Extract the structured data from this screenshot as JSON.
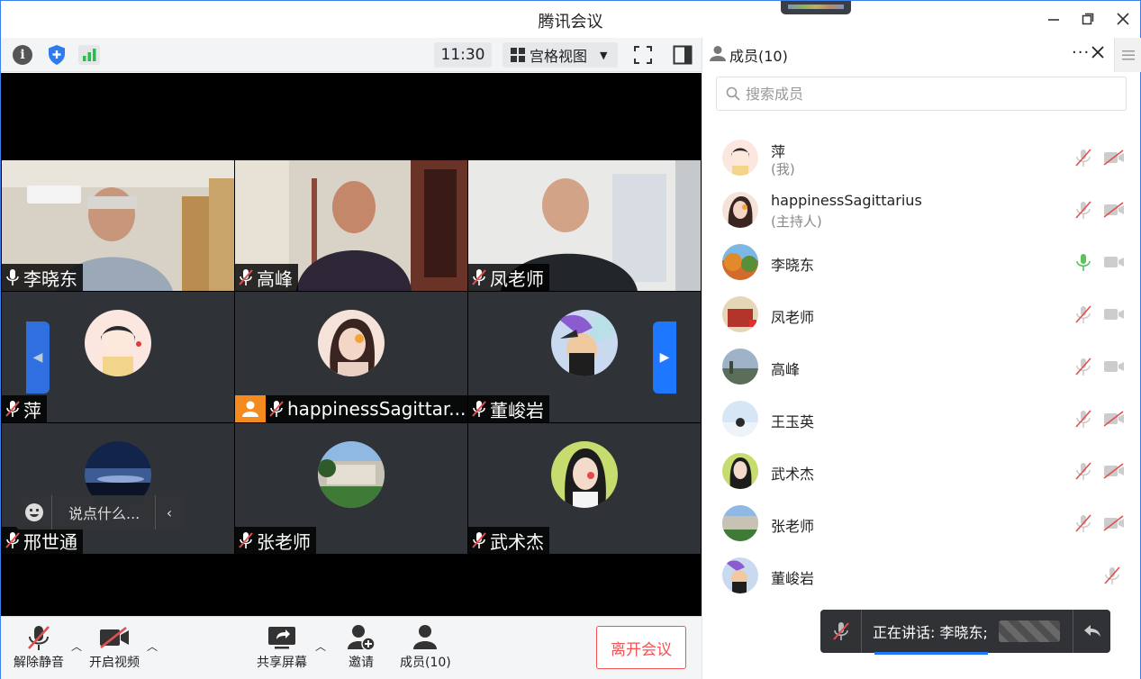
{
  "app": {
    "title": "腾讯会议"
  },
  "toolbar": {
    "time": "11:30",
    "view_label": "宫格视图",
    "icons": [
      "info-icon",
      "shield-icon",
      "signal-icon",
      "fullscreen-icon",
      "sidebar-icon"
    ]
  },
  "tiles": [
    {
      "name": "李晓东",
      "mic": "on",
      "camera": true,
      "active": true
    },
    {
      "name": "高峰",
      "mic": "muted",
      "camera": true
    },
    {
      "name": "凤老师",
      "mic": "muted",
      "camera": true
    },
    {
      "name": "萍",
      "mic": "muted",
      "camera": false
    },
    {
      "name": "happinessSagittar...",
      "mic": "muted",
      "camera": false,
      "host": true
    },
    {
      "name": "董峻岩",
      "mic": "muted",
      "camera": false
    },
    {
      "name": "邢世通",
      "mic": "muted",
      "camera": false
    },
    {
      "name": "张老师",
      "mic": "muted",
      "camera": false
    },
    {
      "name": "武术杰",
      "mic": "muted",
      "camera": false
    }
  ],
  "chat": {
    "placeholder": "说点什么..."
  },
  "bottom": {
    "unmute_label": "解除静音",
    "video_label": "开启视频",
    "share_label": "共享屏幕",
    "invite_label": "邀请",
    "members_label": "成员(10)",
    "leave_label": "离开会议"
  },
  "panel": {
    "title": "成员(10)",
    "search_placeholder": "搜索成员",
    "members": [
      {
        "name": "萍",
        "role": "(我)",
        "mic": "muted",
        "cam": "off"
      },
      {
        "name": "happinessSagittarius",
        "role": "(主持人)",
        "mic": "muted",
        "cam": "off"
      },
      {
        "name": "李晓东",
        "role": "",
        "mic": "on",
        "cam": "on"
      },
      {
        "name": "凤老师",
        "role": "",
        "mic": "muted",
        "cam": "on"
      },
      {
        "name": "高峰",
        "role": "",
        "mic": "muted",
        "cam": "on"
      },
      {
        "name": "王玉英",
        "role": "",
        "mic": "muted",
        "cam": "off"
      },
      {
        "name": "武术杰",
        "role": "",
        "mic": "muted",
        "cam": "off"
      },
      {
        "name": "张老师",
        "role": "",
        "mic": "muted",
        "cam": "off"
      },
      {
        "name": "董峻岩",
        "role": "",
        "mic": "muted",
        "cam": "none"
      }
    ]
  },
  "speaking": {
    "text": "正在讲话: 李晓东;"
  },
  "colors": {
    "accent": "#1e78ff",
    "leave": "#f15454",
    "mic_on": "#5cc35c",
    "muted": "#e05050"
  }
}
